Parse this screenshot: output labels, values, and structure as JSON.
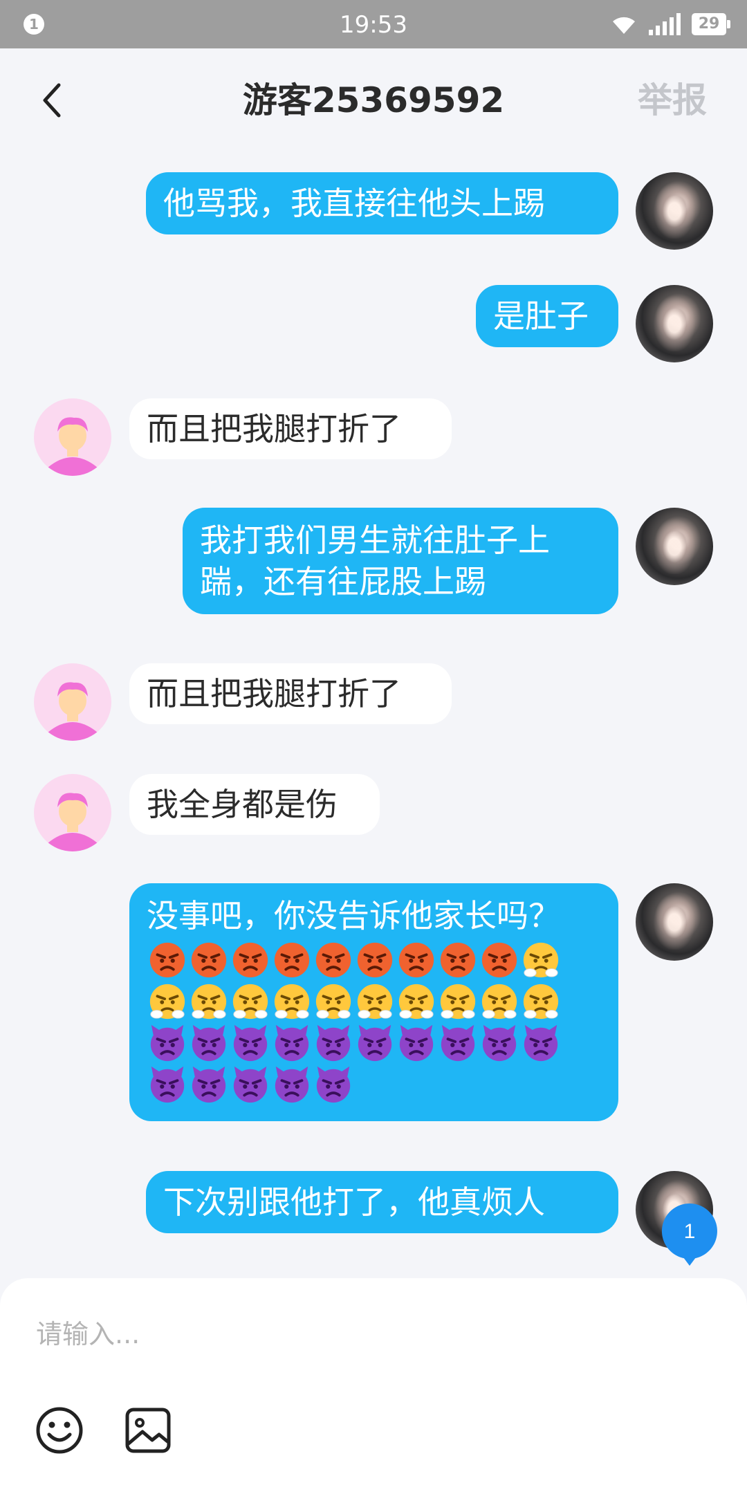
{
  "status_bar": {
    "notification_count": "1",
    "time": "19:53",
    "battery": "29",
    "icons": [
      "wifi-icon",
      "signal-icon",
      "battery-icon"
    ]
  },
  "header": {
    "title": "游客25369592",
    "report_label": "举报",
    "back_icon": "chevron-left-icon"
  },
  "messages": [
    {
      "sender": "self",
      "text": "他骂我，我直接往他头上踢"
    },
    {
      "sender": "self",
      "text": "是肚子"
    },
    {
      "sender": "other",
      "text": "而且把我腿打折了"
    },
    {
      "sender": "self",
      "text": "我打我们男生就往肚子上踹，还有往屁股上踢"
    },
    {
      "sender": "other",
      "text": "而且把我腿打折了"
    },
    {
      "sender": "other",
      "text": "我全身都是伤"
    },
    {
      "sender": "self",
      "text": "没事吧，你没告诉他家长吗？",
      "emojis": {
        "pouting-face": 9,
        "face-with-steam-from-nose": 11,
        "angry-face-with-horns": 15
      }
    },
    {
      "sender": "self",
      "text": "下次别跟他打了，他真烦人"
    }
  ],
  "unread_badge": "1",
  "composer": {
    "placeholder": "请输入...",
    "emoji_icon": "smiley-icon",
    "image_icon": "image-icon"
  },
  "colors": {
    "self_bubble": "#1fb6f5",
    "other_bubble": "#ffffff",
    "background": "#f4f5f9",
    "status_bar": "#9e9e9e",
    "report_text": "#c4c6cb"
  }
}
